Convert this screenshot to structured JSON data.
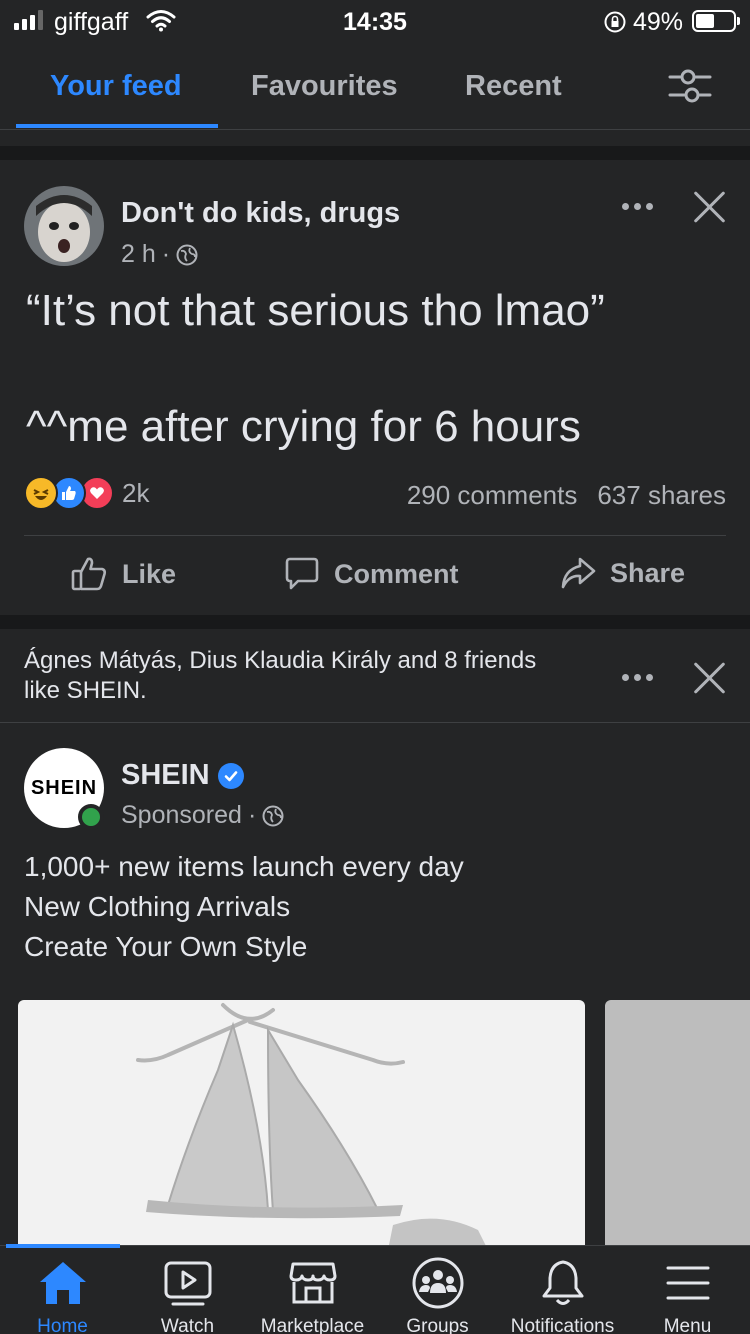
{
  "status_bar": {
    "carrier": "giffgaff",
    "time": "14:35",
    "battery_percent": "49%",
    "battery_level": 0.49
  },
  "tabs": [
    {
      "label": "Your feed",
      "active": true
    },
    {
      "label": "Favourites",
      "active": false
    },
    {
      "label": "Recent",
      "active": false
    }
  ],
  "post": {
    "author": "Don't do kids, drugs",
    "time": "2 h",
    "separator": "·",
    "text_line_1": "“It’s not that serious tho lmao”",
    "text_line_2": "^^me after crying for 6 hours",
    "reaction_count": "2k",
    "comments": "290 comments",
    "shares": "637 shares",
    "actions": {
      "like": "Like",
      "comment": "Comment",
      "share": "Share"
    }
  },
  "suggestion": {
    "social_context": "Ágnes Mátyás, Dius Klaudia Király and 8 friends like SHEIN.",
    "page_name": "SHEIN",
    "logo_text": "SHEIN",
    "sponsored": "Sponsored",
    "separator": "·",
    "lines": [
      "1,000+ new items launch every day",
      "New Clothing Arrivals",
      "Create Your Own Style"
    ]
  },
  "bottom_nav": [
    {
      "label": "Home",
      "icon": "home-icon",
      "active": true
    },
    {
      "label": "Watch",
      "icon": "watch-icon",
      "active": false
    },
    {
      "label": "Marketplace",
      "icon": "marketplace-icon",
      "active": false
    },
    {
      "label": "Groups",
      "icon": "groups-icon",
      "active": false
    },
    {
      "label": "Notifications",
      "icon": "bell-icon",
      "active": false
    },
    {
      "label": "Menu",
      "icon": "menu-icon",
      "active": false
    }
  ],
  "colors": {
    "accent": "#2d88ff",
    "background": "#242526",
    "separator": "#18191a",
    "text": "#e4e6eb",
    "muted": "#b0b3b8"
  }
}
